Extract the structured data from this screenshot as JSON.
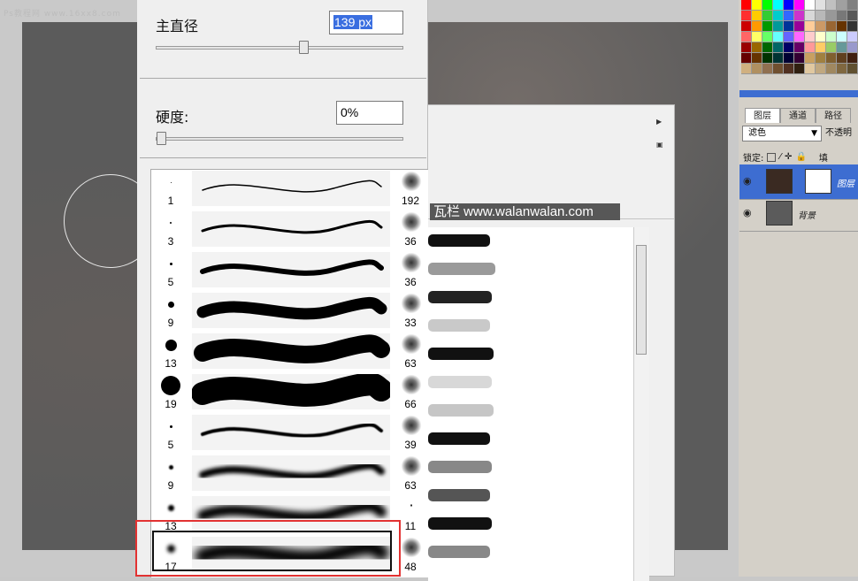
{
  "app": {
    "watermark_top": "Ps教程网 www.16xx8.com",
    "watermark_banner": "瓦栏 www.walanwalan.com"
  },
  "brush_popup": {
    "diameter_label": "主直径",
    "diameter_value": "139 px",
    "diameter_level": 0.6,
    "hardness_label": "硬度:",
    "hardness_value": "0%",
    "hardness_level": 0.0,
    "presets": [
      {
        "size": "1",
        "tip": 1,
        "stroke": 1.5,
        "blur": 0,
        "right_size": "192",
        "right_icon": "star-burst-icon"
      },
      {
        "size": "3",
        "tip": 2,
        "stroke": 3,
        "blur": 0,
        "right_size": "36",
        "right_icon": "scatter-brush-icon"
      },
      {
        "size": "5",
        "tip": 3,
        "stroke": 6,
        "blur": 0,
        "right_size": "36",
        "right_icon": "scatter-brush-icon"
      },
      {
        "size": "9",
        "tip": 7,
        "stroke": 13,
        "blur": 0,
        "right_size": "33",
        "right_icon": "scatter-brush-icon"
      },
      {
        "size": "13",
        "tip": 13,
        "stroke": 20,
        "blur": 0,
        "right_size": "63",
        "right_icon": "scatter-brush-icon"
      },
      {
        "size": "19",
        "tip": 22,
        "stroke": 26,
        "blur": 0,
        "right_size": "66",
        "right_icon": "spray-brush-icon"
      },
      {
        "size": "5",
        "tip": 3,
        "stroke": 4,
        "blur": 0.5,
        "right_size": "39",
        "right_icon": "spray-brush-icon"
      },
      {
        "size": "9",
        "tip": 5,
        "stroke": 8,
        "blur": 2,
        "right_size": "63",
        "right_icon": "scatter-brush-icon"
      },
      {
        "size": "13",
        "tip": 7,
        "stroke": 12,
        "blur": 3.5,
        "right_size": "11",
        "right_icon": "small-dot-icon"
      },
      {
        "size": "17",
        "tip": 9,
        "stroke": 18,
        "blur": 5,
        "right_size": "48",
        "right_icon": "scatter-brush-icon"
      }
    ]
  },
  "layers_panel": {
    "tabs": [
      "图层",
      "通道",
      "路径"
    ],
    "blend_mode": "滤色",
    "opacity_label": "不透明",
    "lock_label": "锁定:",
    "fill_label": "填",
    "layers": [
      {
        "name": "图层",
        "active": true
      },
      {
        "name": "背景",
        "active": false
      }
    ]
  },
  "colors": {
    "accent": "#3d6dd1",
    "highlight": "#e23232"
  }
}
